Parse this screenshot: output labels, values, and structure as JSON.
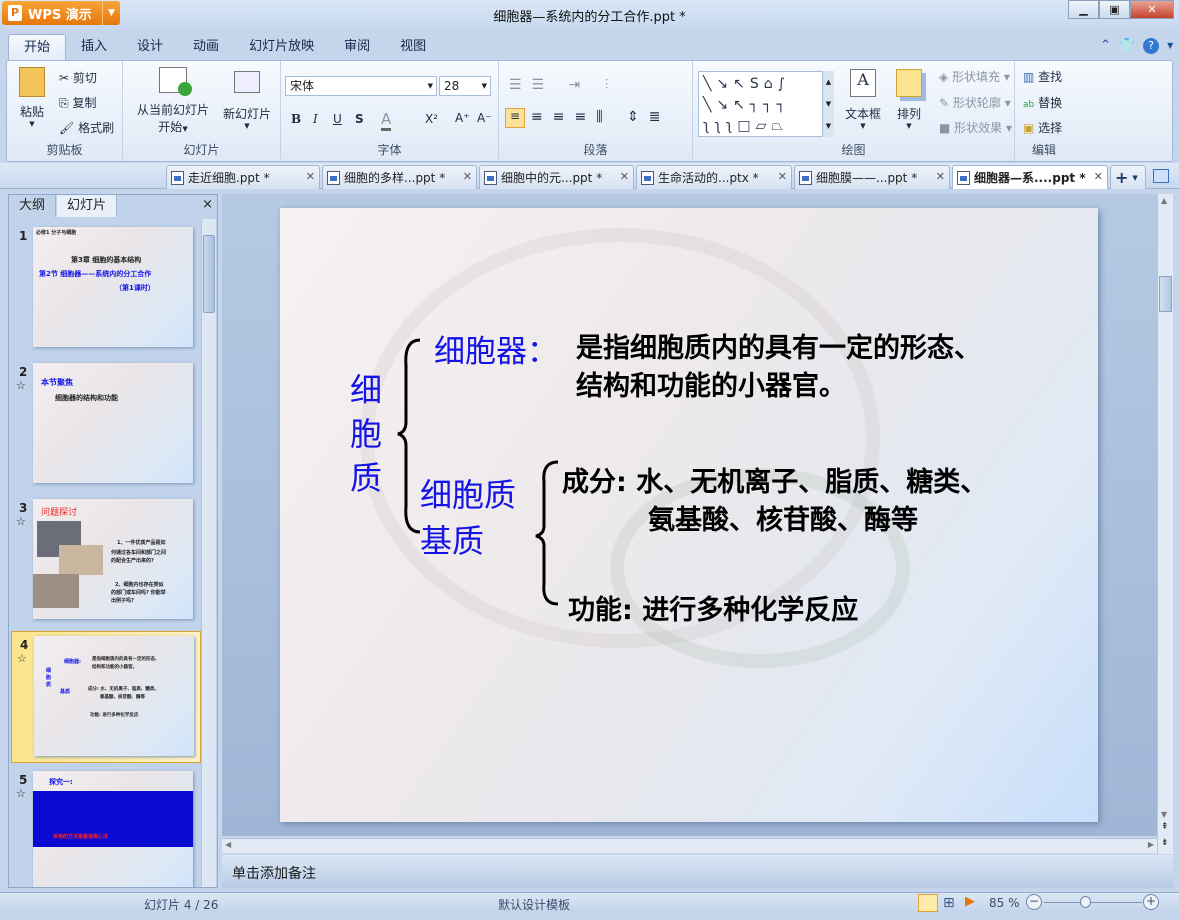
{
  "app": {
    "name": "WPS 演示",
    "title": "细胞器—系统内的分工合作.ppt *"
  },
  "menu_tabs": [
    "开始",
    "插入",
    "设计",
    "动画",
    "幻灯片放映",
    "审阅",
    "视图"
  ],
  "ribbon": {
    "clipboard": {
      "label": "剪贴板",
      "paste": "粘贴",
      "cut": "剪切",
      "copy": "复制",
      "format_painter": "格式刷"
    },
    "slides": {
      "label": "幻灯片",
      "from_current_line1": "从当前幻灯片",
      "from_current_line2": "开始",
      "new_slide": "新幻灯片"
    },
    "font": {
      "label": "字体",
      "font_name": "宋体",
      "font_size": "28",
      "bold": "B",
      "italic": "I",
      "underline": "U",
      "shadow": "S",
      "color": "A",
      "superscript": "X²",
      "grow": "A⁺",
      "shrink": "A⁻"
    },
    "paragraph": {
      "label": "段落"
    },
    "drawing": {
      "label": "绘图",
      "textbox": "文本框",
      "arrange": "排列",
      "shape_fill": "形状填充",
      "shape_outline": "形状轮廓",
      "shape_effect": "形状效果"
    },
    "editing": {
      "label": "编辑",
      "find": "查找",
      "replace": "替换",
      "select": "选择"
    }
  },
  "doc_tabs": [
    {
      "label": "走近细胞.ppt *",
      "active": false
    },
    {
      "label": "细胞的多样...ppt *",
      "active": false
    },
    {
      "label": "细胞中的元...ppt *",
      "active": false
    },
    {
      "label": "生命活动的...ptx *",
      "active": false
    },
    {
      "label": "细胞膜——...ppt *",
      "active": false
    },
    {
      "label": "细胞器—系....ppt *",
      "active": true
    }
  ],
  "panel": {
    "tabs": [
      "大纲",
      "幻灯片"
    ],
    "active_tab": "幻灯片",
    "close": "×"
  },
  "thumbnails": [
    {
      "num": "1",
      "lines": [
        "必修1  分子与细胞",
        "第3章    细胞的基本结构",
        "第2节   细胞器——系统内的分工合作",
        "（第1课时）"
      ]
    },
    {
      "num": "2",
      "lines": [
        "本节聚焦",
        "细胞器的结构和功能"
      ]
    },
    {
      "num": "3",
      "lines": [
        "问题探讨",
        "1、一件优质产品是如",
        "何通过各车间和部门之间",
        "的配合生产出来的?",
        "2、细胞内也存在类似",
        "的部门或车间吗? 你能举",
        "出例子吗?"
      ]
    },
    {
      "num": "4",
      "lines": [
        "细胞器:",
        "是指细胞质内的具有一定的形态、",
        "结构和功能的小器官。",
        "细胞质",
        "基质",
        "成分: 水、无机离子、脂质、糖类、",
        "氨基酸、核苷酸、酶等",
        "功能: 进行多种化学反应"
      ]
    },
    {
      "num": "5",
      "lines": [
        "探究一:",
        "采用的方法是差速离心法"
      ]
    }
  ],
  "slide": {
    "left_label": [
      "细",
      "胞",
      "质"
    ],
    "organelle_term": "细胞器：",
    "organelle_def": [
      "是指细胞质内的具有一定的形态、",
      "结构和功能的小器官。"
    ],
    "matrix_term": [
      "细胞质",
      "基质"
    ],
    "composition": [
      "成分: 水、无机离子、脂质、糖类、",
      "氨基酸、核苷酸、酶等"
    ],
    "function": "功能:  进行多种化学反应"
  },
  "notes_placeholder": "单击添加备注",
  "status": {
    "slide_counter": "幻灯片 4 / 26",
    "template": "默认设计模板",
    "zoom": "85 %",
    "zoom_percent": 85
  },
  "colors": {
    "accent_orange": "#e6760c",
    "slide_blue": "#1414e6"
  }
}
